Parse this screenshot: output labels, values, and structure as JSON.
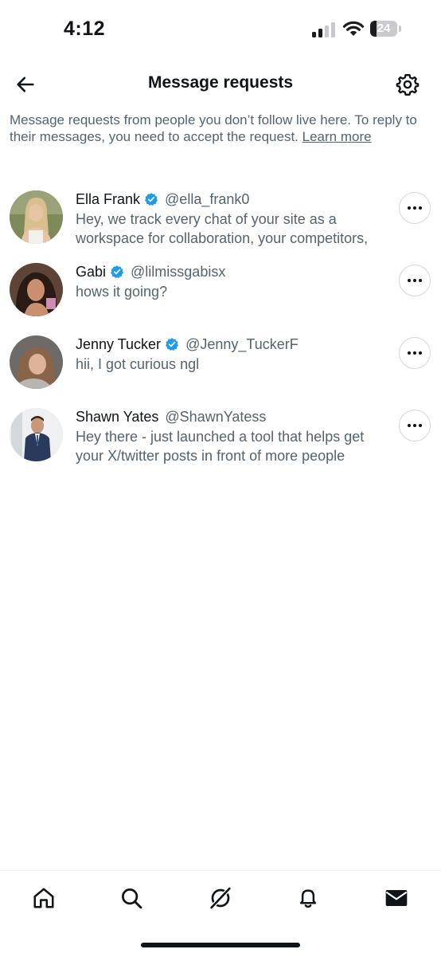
{
  "status_bar": {
    "time": "4:12",
    "battery": "24",
    "battery_level": 0.24
  },
  "header": {
    "title": "Message requests",
    "back_icon": "arrow-left-icon",
    "settings_icon": "gear-icon"
  },
  "info": {
    "text": "Message requests from people you don’t follow live here. To reply to their messages, you need to accept the request.",
    "link_label": "Learn more"
  },
  "requests": [
    {
      "name": "Ella Frank",
      "verified": true,
      "handle": "@ella_frank0",
      "preview": "Hey, we track every chat of your site as a workspace for collaboration, your competitors,"
    },
    {
      "name": "Gabi",
      "verified": true,
      "handle": "@lilmissgabisx",
      "preview": "hows it going?"
    },
    {
      "name": "Jenny Tucker",
      "verified": true,
      "handle": "@Jenny_TuckerF",
      "preview": "hii, I got curious ngl"
    },
    {
      "name": "Shawn Yates",
      "verified": false,
      "handle": "@ShawnYatess",
      "preview": "Hey there -  just launched a tool that helps get your X/twitter posts in front of more people"
    }
  ],
  "nav": [
    "home-icon",
    "search-icon",
    "grok-icon",
    "bell-icon",
    "mail-icon"
  ],
  "colors": {
    "verified": "#1d9bf0",
    "text": "#0f1419",
    "secondary": "#536471"
  }
}
